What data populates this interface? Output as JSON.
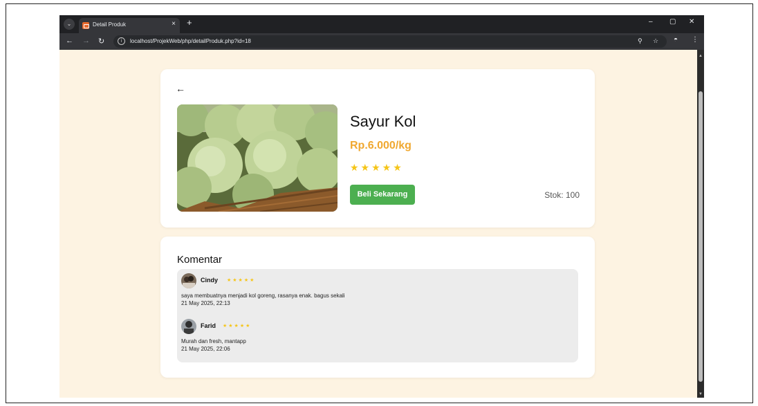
{
  "browser": {
    "tab_title": "Detail Produk",
    "tab_close": "×",
    "new_tab": "+",
    "url": "localhost/ProjekWeb/php/detailProduk.php?id=18",
    "window_controls": {
      "minimize": "–",
      "maximize": "▢",
      "close": "✕"
    }
  },
  "product": {
    "back": "←",
    "name": "Sayur Kol",
    "price": "Rp.6.000/kg",
    "rating_stars": "★★★★★",
    "rating": 5,
    "buy_label": "Beli Sekarang",
    "stock_text": "Stok: 100",
    "image": "cabbage-photo"
  },
  "comments": {
    "title": "Komentar",
    "items": [
      {
        "user": "Cindy",
        "stars": "★★★★★",
        "rating": 5,
        "text": "saya membuatnya menjadi kol goreng, rasanya enak. bagus sekali",
        "date": "21 May 2025, 22:13"
      },
      {
        "user": "Farid",
        "stars": "★★★★★",
        "rating": 5,
        "text": "Murah dan fresh, mantapp",
        "date": "21 May 2025, 22:06"
      }
    ]
  },
  "colors": {
    "page_bg": "#fdf3e2",
    "price": "#f0a830",
    "star": "#f5c518",
    "buy_button": "#4caf50",
    "browser_dark": "#202124"
  }
}
